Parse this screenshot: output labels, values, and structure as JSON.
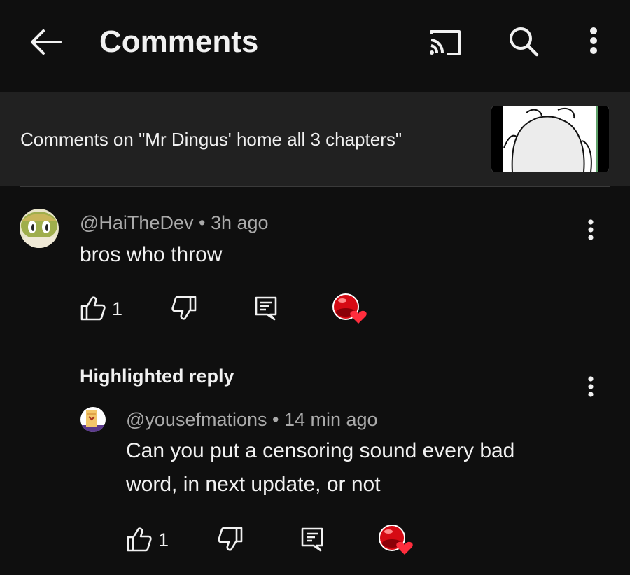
{
  "header": {
    "title": "Comments",
    "back_icon": "arrow-left-icon",
    "cast_icon": "cast-icon",
    "search_icon": "search-icon",
    "more_icon": "more-vert-icon"
  },
  "banner": {
    "text": "Comments on \"Mr Dingus' home all 3 chapters\""
  },
  "comment": {
    "author": "@HaiTheDev",
    "time": "3h ago",
    "text": "bros who throw",
    "likes": "1"
  },
  "reply": {
    "label": "Highlighted reply",
    "author": "@yousefmations",
    "time": "14 min ago",
    "text_line1": "Can you put a censoring sound every bad",
    "text_line2": "word, in next update, or not",
    "likes": "1"
  },
  "colors": {
    "background": "#0f0f0f",
    "banner": "#212121",
    "heart": "#ff2d3d",
    "secondary_text": "#aaaaaa"
  }
}
